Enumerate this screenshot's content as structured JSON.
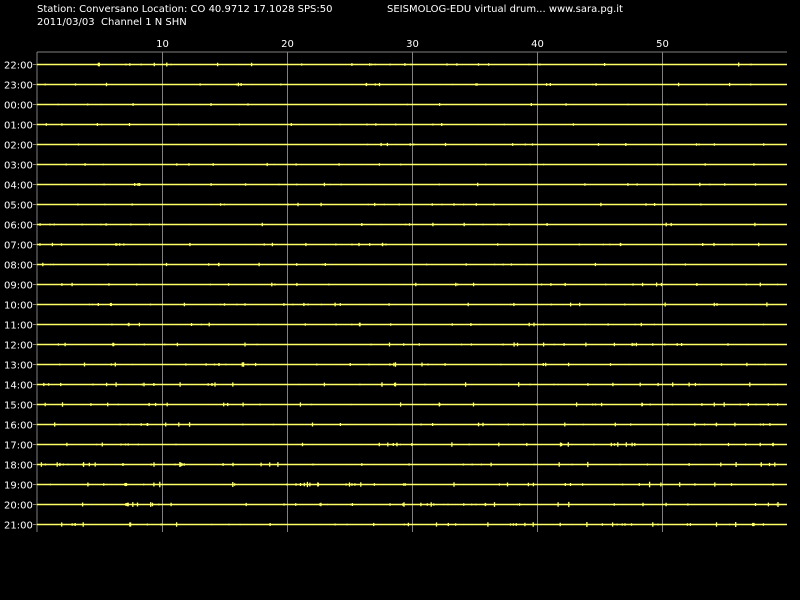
{
  "header": {
    "station_line": "Station: Conversano Location: CO 40.9712 17.1028 SPS:50",
    "date_line": "2011/03/03  Channel 1 N SHN",
    "brand_line": "SEISMOLOG-EDU virtual drum... www.sara.pg.it"
  },
  "colors": {
    "background": "#000000",
    "trace": "#ffff66",
    "grid": "#808080",
    "text": "#ffffff"
  },
  "chart_data": {
    "type": "line",
    "title": "",
    "xlabel": "",
    "ylabel": "",
    "xlim": [
      0,
      60
    ],
    "x_ticks": [
      10,
      20,
      30,
      40,
      50
    ],
    "grid": true,
    "rows": [
      "22:00",
      "23:00",
      "00:00",
      "01:00",
      "02:00",
      "03:00",
      "04:00",
      "05:00",
      "06:00",
      "07:00",
      "08:00",
      "09:00",
      "10:00",
      "11:00",
      "12:00",
      "13:00",
      "14:00",
      "15:00",
      "16:00",
      "17:00",
      "18:00",
      "19:00",
      "20:00",
      "21:00"
    ],
    "row_activity": [
      0.3,
      0.2,
      0.1,
      0.1,
      0.1,
      0.15,
      0.2,
      0.2,
      0.25,
      0.3,
      0.2,
      0.3,
      0.35,
      0.3,
      0.35,
      0.4,
      0.45,
      0.45,
      0.45,
      0.5,
      0.6,
      0.65,
      0.6,
      0.6
    ]
  }
}
